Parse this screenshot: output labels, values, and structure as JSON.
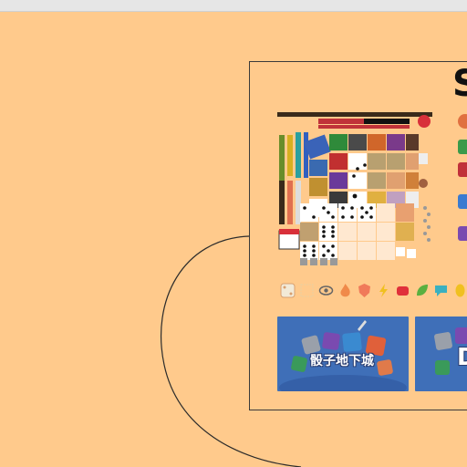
{
  "card": {
    "title": "S"
  },
  "banners": [
    {
      "title": "骰子地下城"
    },
    {
      "title": "D"
    }
  ],
  "icons": [
    "dice-icon",
    "frame-icon",
    "eye-icon",
    "fire-icon",
    "shield-icon",
    "lightning-icon",
    "fist-icon",
    "leaf-icon",
    "speech-bubble-icon",
    "coin-icon"
  ],
  "colors": {
    "background": "#FFCA8C",
    "banner": "#3F6FB8",
    "topbar": "#E6E6E6"
  }
}
